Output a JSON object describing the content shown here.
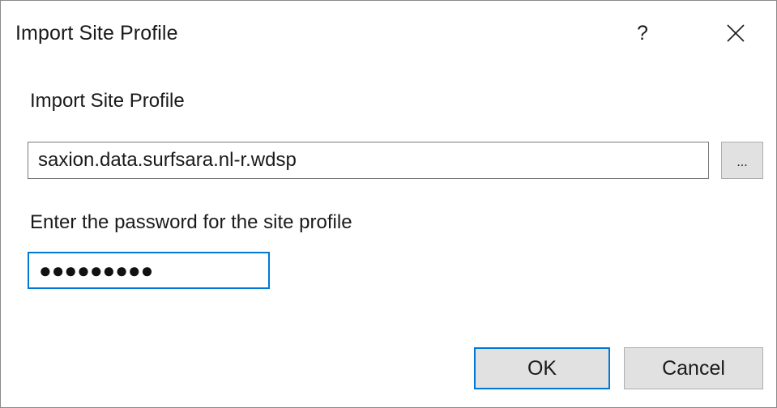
{
  "dialog": {
    "title": "Import Site Profile",
    "help_label": "?",
    "close_icon": "close-icon"
  },
  "profile": {
    "section_label": "Import Site Profile",
    "file_value": "saxion.data.surfsara.nl-r.wdsp",
    "browse_label": "..."
  },
  "password": {
    "label": "Enter the password for the site profile",
    "masked_value": "●●●●●●●●●"
  },
  "buttons": {
    "ok_label": "OK",
    "cancel_label": "Cancel"
  },
  "colors": {
    "focus_accent": "#0078d7",
    "button_face": "#e1e1e1"
  }
}
